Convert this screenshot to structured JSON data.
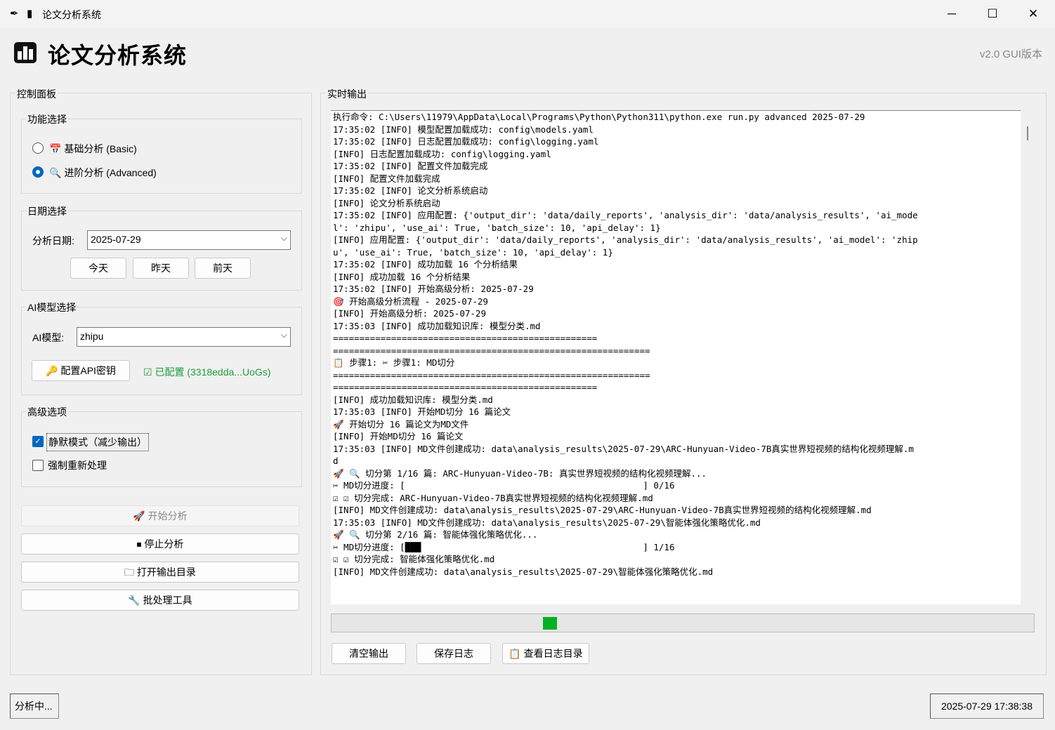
{
  "window": {
    "title": "论文分析系统",
    "minimize_glyph": "─",
    "maximize_glyph": "☐",
    "close_glyph": "✕"
  },
  "header": {
    "title": "论文分析系统",
    "version": "v2.0 GUI版本"
  },
  "control_panel": {
    "title": "控制面板",
    "function_group": {
      "title": "功能选择",
      "options": [
        {
          "label": "📅 基础分析 (Basic)",
          "selected": false
        },
        {
          "label": "🔍 进阶分析 (Advanced)",
          "selected": true
        }
      ]
    },
    "date_group": {
      "title": "日期选择",
      "date_label": "分析日期:",
      "date_value": "2025-07-29",
      "today": "今天",
      "yesterday": "昨天",
      "day_before": "前天"
    },
    "model_group": {
      "title": "AI模型选择",
      "model_label": "AI模型:",
      "model_value": "zhipu",
      "config_button": "🔑 配置API密钥",
      "config_status": "☑ 已配置 (3318edda...UoGs)",
      "status_color": "#1e9e3a"
    },
    "advanced_group": {
      "title": "高级选项",
      "quiet_mode": {
        "label": "静默模式（减少输出）",
        "checked": true
      },
      "force_reprocess": {
        "label": "强制重新处理",
        "checked": false
      }
    },
    "actions": {
      "start": "🚀 开始分析",
      "stop": "⏹ 停止分析",
      "open_output": "🗀 打开输出目录",
      "batch": "🔧 批处理工具"
    }
  },
  "output_panel": {
    "title": "实时输出",
    "log_lines": [
      "执行命令: C:\\Users\\11979\\AppData\\Local\\Programs\\Python\\Python311\\python.exe run.py advanced 2025-07-29",
      "17:35:02 [INFO] 模型配置加载成功: config\\models.yaml",
      "17:35:02 [INFO] 日志配置加载成功: config\\logging.yaml",
      "[INFO] 日志配置加载成功: config\\logging.yaml",
      "17:35:02 [INFO] 配置文件加载完成",
      "[INFO] 配置文件加载完成",
      "17:35:02 [INFO] 论文分析系统启动",
      "[INFO] 论文分析系统启动",
      "17:35:02 [INFO] 应用配置: {'output_dir': 'data/daily_reports', 'analysis_dir': 'data/analysis_results', 'ai_mode",
      "l': 'zhipu', 'use_ai': True, 'batch_size': 10, 'api_delay': 1}",
      "[INFO] 应用配置: {'output_dir': 'data/daily_reports', 'analysis_dir': 'data/analysis_results', 'ai_model': 'zhip",
      "u', 'use_ai': True, 'batch_size': 10, 'api_delay': 1}",
      "17:35:02 [INFO] 成功加载 16 个分析结果",
      "[INFO] 成功加载 16 个分析结果",
      "17:35:02 [INFO] 开始高级分析: 2025-07-29",
      "",
      "🎯 开始高级分析流程 - 2025-07-29",
      "[INFO] 开始高级分析: 2025-07-29",
      "17:35:03 [INFO] 成功加载知识库: 模型分类.md",
      "==================================================",
      "",
      "============================================================",
      "📋 步骤1: ✂ 步骤1: MD切分",
      "============================================================",
      "==================================================",
      "[INFO] 成功加载知识库: 模型分类.md",
      "17:35:03 [INFO] 开始MD切分 16 篇论文",
      "🚀 开始切分 16 篇论文为MD文件",
      "[INFO] 开始MD切分 16 篇论文",
      "17:35:03 [INFO] MD文件创建成功: data\\analysis_results\\2025-07-29\\ARC-Hunyuan-Video-7B真实世界短视频的结构化视频理解.m",
      "d",
      "🚀 🔍 切分第 1/16 篇: ARC-Hunyuan-Video-7B: 真实世界短视频的结构化视频理解...",
      "✂ MD切分进度: [                                             ] 0/16",
      "☑ ☑ 切分完成: ARC-Hunyuan-Video-7B真实世界短视频的结构化视频理解.md",
      "[INFO] MD文件创建成功: data\\analysis_results\\2025-07-29\\ARC-Hunyuan-Video-7B真实世界短视频的结构化视频理解.md",
      "17:35:03 [INFO] MD文件创建成功: data\\analysis_results\\2025-07-29\\智能体强化策略优化.md",
      "🚀 🔍 切分第 2/16 篇: 智能体强化策略优化...",
      "✂ MD切分进度: [███                                          ] 1/16",
      "☑ ☑ 切分完成: 智能体强化策略优化.md",
      "[INFO] MD文件创建成功: data\\analysis_results\\2025-07-29\\智能体强化策略优化.md"
    ],
    "progress_fraction": 0.31,
    "progress_color": "#06b025",
    "clear_button": "清空输出",
    "save_button": "保存日志",
    "view_log_button": "📋 查看日志目录"
  },
  "statusbar": {
    "status": "分析中...",
    "datetime": "2025-07-29 17:38:38"
  }
}
